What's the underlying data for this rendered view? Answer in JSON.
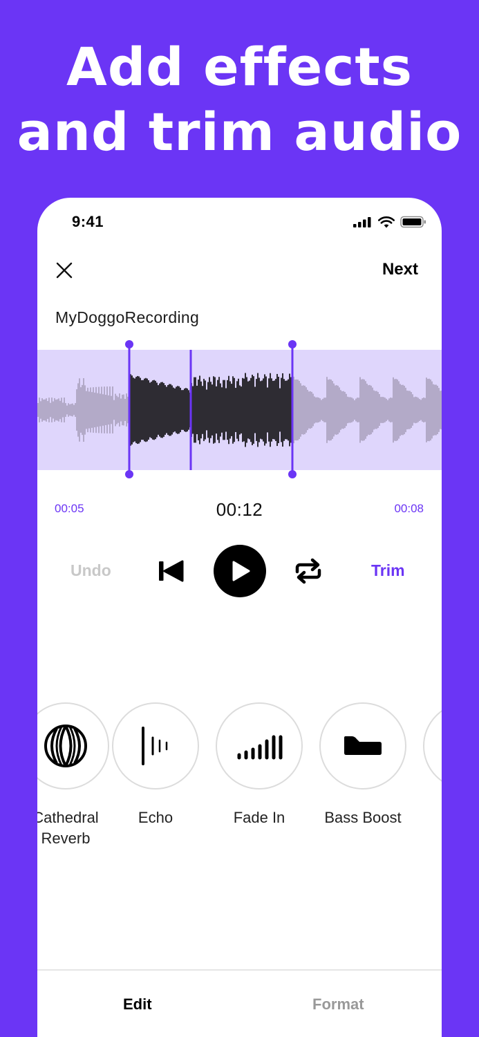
{
  "headline": {
    "line1": "Add effects",
    "line2": "and trim audio"
  },
  "status": {
    "time": "9:41"
  },
  "header": {
    "next_label": "Next"
  },
  "recording": {
    "title": "MyDoggoRecording"
  },
  "timeline": {
    "start": "00:05",
    "current": "00:12",
    "end": "00:08"
  },
  "controls": {
    "undo_label": "Undo",
    "trim_label": "Trim"
  },
  "effects": [
    {
      "line1": "Cathedral",
      "line2": "Reverb",
      "icon": "cathedral-reverb-icon"
    },
    {
      "line1": "Echo",
      "line2": "",
      "icon": "echo-icon"
    },
    {
      "line1": "Fade In",
      "line2": "",
      "icon": "fade-in-icon"
    },
    {
      "line1": "Bass Boost",
      "line2": "",
      "icon": "bass-boost-icon"
    }
  ],
  "tabs": {
    "edit": "Edit",
    "format": "Format"
  },
  "colors": {
    "accent": "#6B35F5",
    "wave_bg": "#DFD6FC",
    "wave_selected": "#2E2C33",
    "wave_unselected": "#B3AAC8"
  }
}
